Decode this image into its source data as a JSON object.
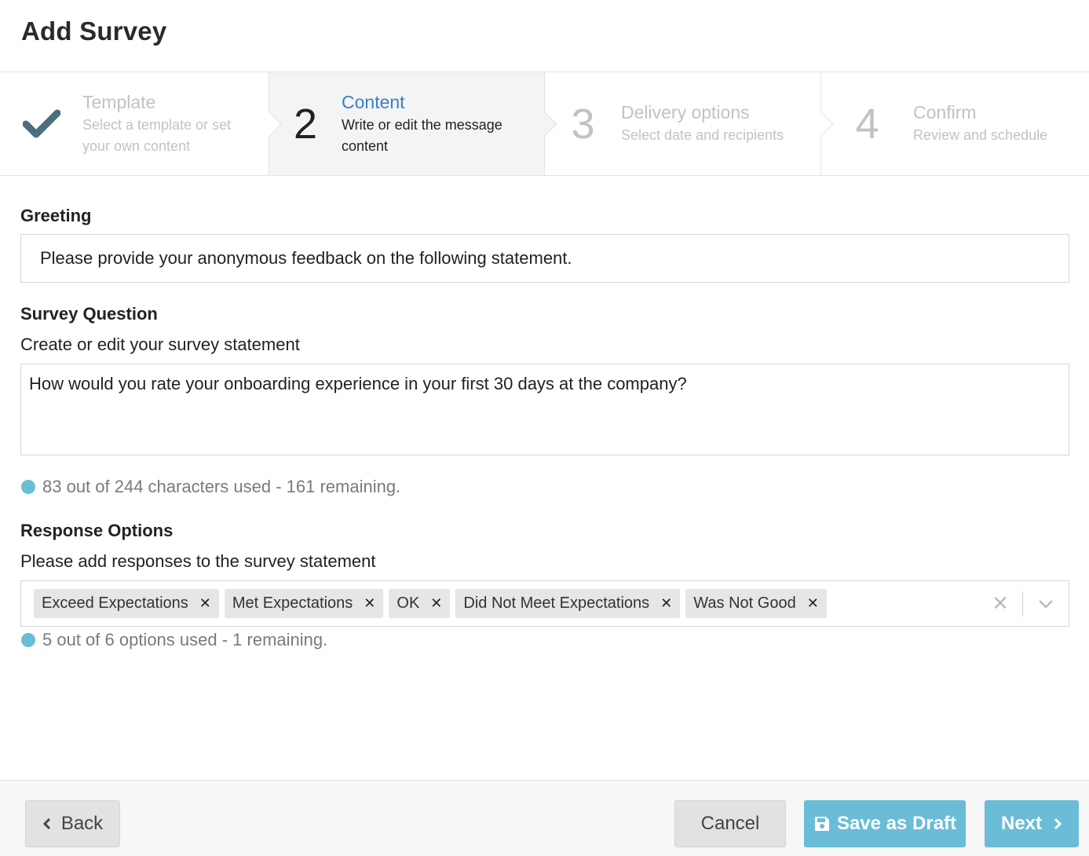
{
  "page": {
    "title": "Add Survey"
  },
  "steps": [
    {
      "marker": "",
      "title": "Template",
      "desc_line1": "Select a template or set",
      "desc_line2": "your own content",
      "state": "done"
    },
    {
      "marker": "2",
      "title": "Content",
      "desc_line1": "Write or edit the message",
      "desc_line2": "content",
      "state": "active"
    },
    {
      "marker": "3",
      "title": "Delivery options",
      "desc_line1": "Select date and recipients",
      "desc_line2": "",
      "state": "pending"
    },
    {
      "marker": "4",
      "title": "Confirm",
      "desc_line1": "Review and schedule",
      "desc_line2": "",
      "state": "pending"
    }
  ],
  "greeting": {
    "label": "Greeting",
    "value": "Please provide your anonymous feedback on the following statement."
  },
  "question": {
    "label": "Survey Question",
    "sublabel": "Create or edit your survey statement",
    "value": "How would you rate your onboarding experience in your first 30 days at the company?",
    "counter": "83 out of 244 characters used - 161 remaining."
  },
  "responses": {
    "label": "Response Options",
    "sublabel": "Please add responses to the survey statement",
    "chips": [
      "Exceed Expectations",
      "Met Expectations",
      "OK",
      "Did Not Meet Expectations",
      "Was Not Good"
    ],
    "counter": "5 out of 6 options used - 1 remaining."
  },
  "footer": {
    "back_label": "Back",
    "cancel_label": "Cancel",
    "draft_label": "Save as Draft",
    "next_label": "Next"
  },
  "colors": {
    "accent": "#6bbcd6",
    "active_step": "#3b7fc4",
    "check": "#4a6f7c"
  },
  "icons": {
    "step1": "checkmark-icon",
    "chip_remove": "close-icon",
    "clear": "clear-icon",
    "dropdown": "chevron-down-icon",
    "back": "chevron-left-icon",
    "draft": "floppy-disk-icon",
    "next": "chevron-right-icon"
  }
}
